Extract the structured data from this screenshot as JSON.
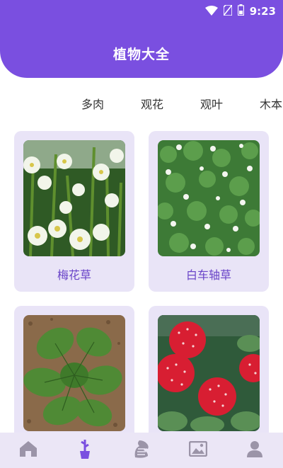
{
  "status_bar": {
    "time": "9:23",
    "icons": [
      "wifi-icon",
      "no-sim-icon",
      "battery-icon"
    ]
  },
  "header": {
    "title": "植物大全"
  },
  "colors": {
    "primary": "#7a4fe0",
    "card_bg": "#e9e4f7",
    "nav_bg": "#ebe6f6",
    "label": "#6a45c8"
  },
  "tabs": [
    {
      "label": "多肉"
    },
    {
      "label": "观花"
    },
    {
      "label": "观叶"
    },
    {
      "label": "木本"
    }
  ],
  "plants": [
    {
      "name": "梅花草",
      "image": "white-flower-photo"
    },
    {
      "name": "白车轴草",
      "image": "white-clover-photo"
    },
    {
      "name": "",
      "image": "rosette-leaf-photo"
    },
    {
      "name": "",
      "image": "wild-strawberry-photo"
    }
  ],
  "bottom_nav": {
    "items": [
      {
        "icon": "home-icon",
        "active": false
      },
      {
        "icon": "potted-plant-icon",
        "active": true
      },
      {
        "icon": "dragon-icon",
        "active": false
      },
      {
        "icon": "gallery-icon",
        "active": false
      },
      {
        "icon": "user-icon",
        "active": false
      }
    ]
  }
}
